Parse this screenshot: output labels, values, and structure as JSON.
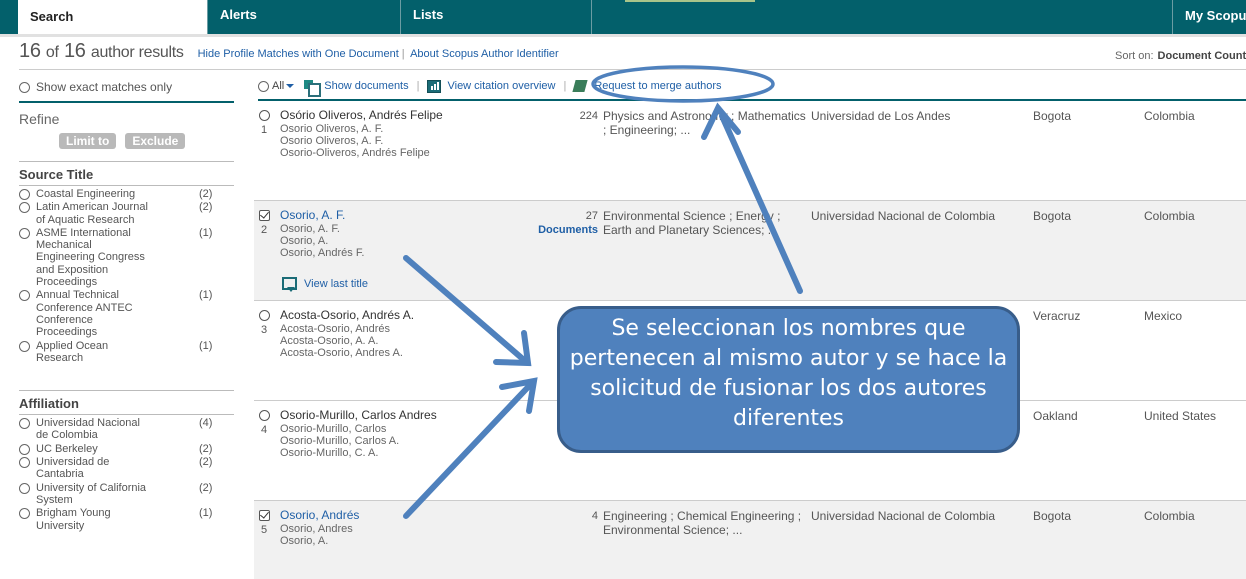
{
  "nav": {
    "tabs": [
      {
        "label": "Search",
        "active": true
      },
      {
        "label": "Alerts",
        "active": false
      },
      {
        "label": "Lists",
        "active": false
      },
      {
        "label": "My Scopus",
        "active": false
      }
    ]
  },
  "results": {
    "shown": "16",
    "of_label": "of",
    "total": "16",
    "label": "author results",
    "links": [
      "Hide Profile Matches with One Document",
      "About Scopus Author Identifier"
    ],
    "sort_label": "Sort on:",
    "sort_value": "Document Count"
  },
  "sidebar": {
    "exact_matches_label": "Show exact matches only",
    "refine_label": "Refine",
    "limit_button": "Limit to",
    "exclude_button": "Exclude",
    "source_title": {
      "title": "Source Title",
      "items": [
        {
          "label": "Coastal Engineering",
          "count": "(2)"
        },
        {
          "label": "Latin American Journal of Aquatic Research",
          "count": "(2)"
        },
        {
          "label": "ASME International Mechanical Engineering Congress and Exposition Proceedings",
          "count": "(1)"
        },
        {
          "label": "Annual Technical Conference ANTEC Conference Proceedings",
          "count": "(1)"
        },
        {
          "label": "Applied Ocean Research",
          "count": "(1)"
        }
      ]
    },
    "affiliation": {
      "title": "Affiliation",
      "items": [
        {
          "label": "Universidad Nacional de Colombia",
          "count": "(4)"
        },
        {
          "label": "UC Berkeley",
          "count": "(2)"
        },
        {
          "label": "Universidad de Cantabria",
          "count": "(2)"
        },
        {
          "label": "University of California System",
          "count": "(2)"
        },
        {
          "label": "Brigham Young University",
          "count": "(1)"
        }
      ]
    }
  },
  "toolbar": {
    "all_label": "All",
    "show_documents": "Show documents",
    "view_citation_overview": "View citation overview",
    "request_merge": "Request to merge authors"
  },
  "authors": [
    {
      "index": "1",
      "checked": false,
      "name": "Osório Oliveros, Andrés Felipe",
      "variants": [
        "Osorio Oliveros, A. F.",
        "Osorio Oliveros, A. F.",
        "Osorio-Oliveros, Andrés Felipe"
      ],
      "documents": "224",
      "documents_label": "",
      "areas": "Physics and Astronomy ; Mathematics ; Engineering; ...",
      "affiliation": "Universidad de Los Andes",
      "city": "Bogota",
      "country": "Colombia"
    },
    {
      "index": "2",
      "checked": true,
      "name": "Osorio, A. F.",
      "variants": [
        "Osorio, A. F.",
        "Osorio, A.",
        "Osorio, Andrés F."
      ],
      "documents": "27",
      "documents_label": "Documents",
      "areas": "Environmental Science ; Energy ; Earth and Planetary Sciences; ...",
      "affiliation": "Universidad Nacional de Colombia",
      "city": "Bogota",
      "country": "Colombia",
      "view_last_title": "View last title"
    },
    {
      "index": "3",
      "checked": false,
      "name": "Acosta-Osorio, Andrés A.",
      "variants": [
        "Acosta-Osorio, Andrés",
        "Acosta-Osorio, A. A.",
        "Acosta-Osorio, Andres A."
      ],
      "documents": "",
      "documents_label": "",
      "areas": "",
      "affiliation": "",
      "city": "Veracruz",
      "country": "Mexico"
    },
    {
      "index": "4",
      "checked": false,
      "name": "Osorio-Murillo, Carlos Andres",
      "variants": [
        "Osorio-Murillo, Carlos",
        "Osorio-Murillo, Carlos A.",
        "Osorio-Murillo, C. A."
      ],
      "documents": "",
      "documents_label": "",
      "areas": "",
      "affiliation": "",
      "city": "Oakland",
      "country": "United States"
    },
    {
      "index": "5",
      "checked": true,
      "name": "Osorio, Andrés",
      "variants": [
        "Osorio, Andres",
        "Osorio, A."
      ],
      "documents": "4",
      "documents_label": "",
      "areas": "Engineering ; Chemical Engineering ; Environmental Science; ...",
      "affiliation": "Universidad Nacional de Colombia",
      "city": "Bogota",
      "country": "Colombia"
    }
  ],
  "annotation": {
    "callout_text": "Se seleccionan  los nombres que pertenecen  al  mismo autor y se hace la solicitud de fusionar los dos autores diferentes",
    "color": "#4f81bd"
  }
}
